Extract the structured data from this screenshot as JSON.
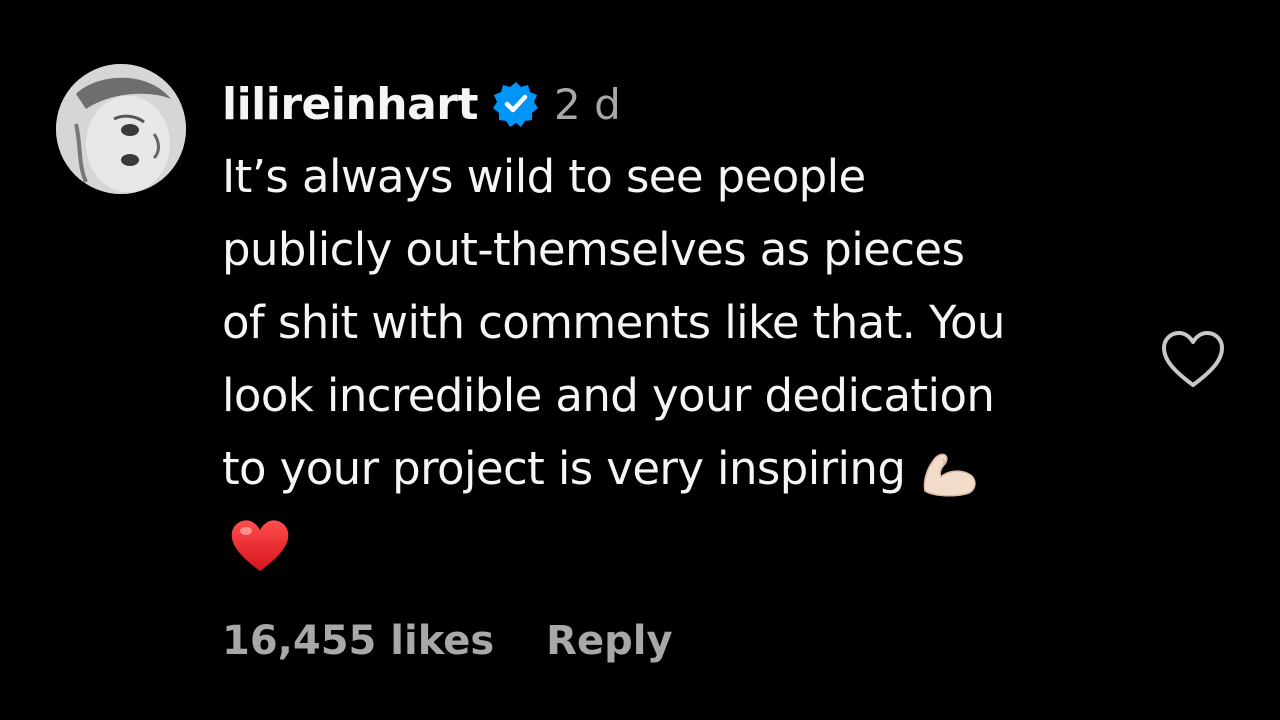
{
  "comment": {
    "username": "lilireinhart",
    "time": "2 d",
    "text_lines": [
      "It’s always wild to see people",
      "publicly out-themselves as pieces",
      "of shit with comments like that. You",
      "look incredible and your dedication",
      "to your project is very inspiring"
    ],
    "emojis": [
      "flexed-biceps",
      "red-heart"
    ],
    "likes": "16,455 likes",
    "reply_label": "Reply",
    "icons": {
      "verified": "verified-badge-icon",
      "like": "heart-outline-icon"
    }
  },
  "colors": {
    "background": "#000000",
    "text": "#f5f5f5",
    "muted": "#a8a8a8",
    "verified": "#0095f6"
  }
}
